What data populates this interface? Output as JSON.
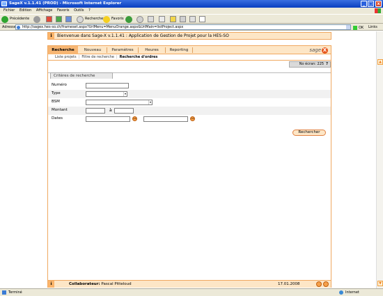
{
  "window": {
    "title": "SageX v.1.1.41 (PROD) - Microsoft Internet Explorer",
    "min": "_",
    "max": "□",
    "close": "x"
  },
  "menubar": [
    "Fichier",
    "Edition",
    "Affichage",
    "Favoris",
    "Outils",
    "?"
  ],
  "toolbar": {
    "back_label": "Précédente",
    "search_label": "Rechercher",
    "favorites_label": "Favoris"
  },
  "address": {
    "label": "Adresse",
    "url": "http://sagex.hes-so.ch/frameset.aspx?UrlMenu=MenuOrange.aspx&UrlMain=listProject.aspx",
    "ok_label": "OK",
    "links_label": "Links"
  },
  "app": {
    "info_icon": "i",
    "welcome": "Bienvenue dans Sage-X v.1.1.41 : Application de Gestion de Projet pour la HES-SO",
    "tabs": [
      {
        "label": "Recherche",
        "active": true
      },
      {
        "label": "Nouveau",
        "active": false
      },
      {
        "label": "Paramètres",
        "active": false
      },
      {
        "label": "Heures",
        "active": false
      },
      {
        "label": "Reporting",
        "active": false
      }
    ],
    "logo_text": "sage",
    "logo_x": "X",
    "subnav": {
      "items": [
        "Liste projets",
        "Filtre de recherche",
        "Recherche d'ordres"
      ],
      "separator": "|"
    },
    "no_ecran": "No écran: 225",
    "help": "?",
    "criteria": {
      "title": "Critères de recherche",
      "fields": {
        "numero": "Numéro",
        "type": "Type",
        "bsm": "BSM",
        "montant": "Montant",
        "montant_sep": "à",
        "dates": "Dates",
        "cal_icon": "cal"
      },
      "dd_arrow": "▾"
    },
    "search_button": "Rechercher",
    "footer": {
      "collab_label": "Collaborateur:",
      "collab_name": "Pascal Pitteloud",
      "date": "17.01.2008"
    }
  },
  "status": {
    "left": "Terminé",
    "zone": "Internet"
  }
}
